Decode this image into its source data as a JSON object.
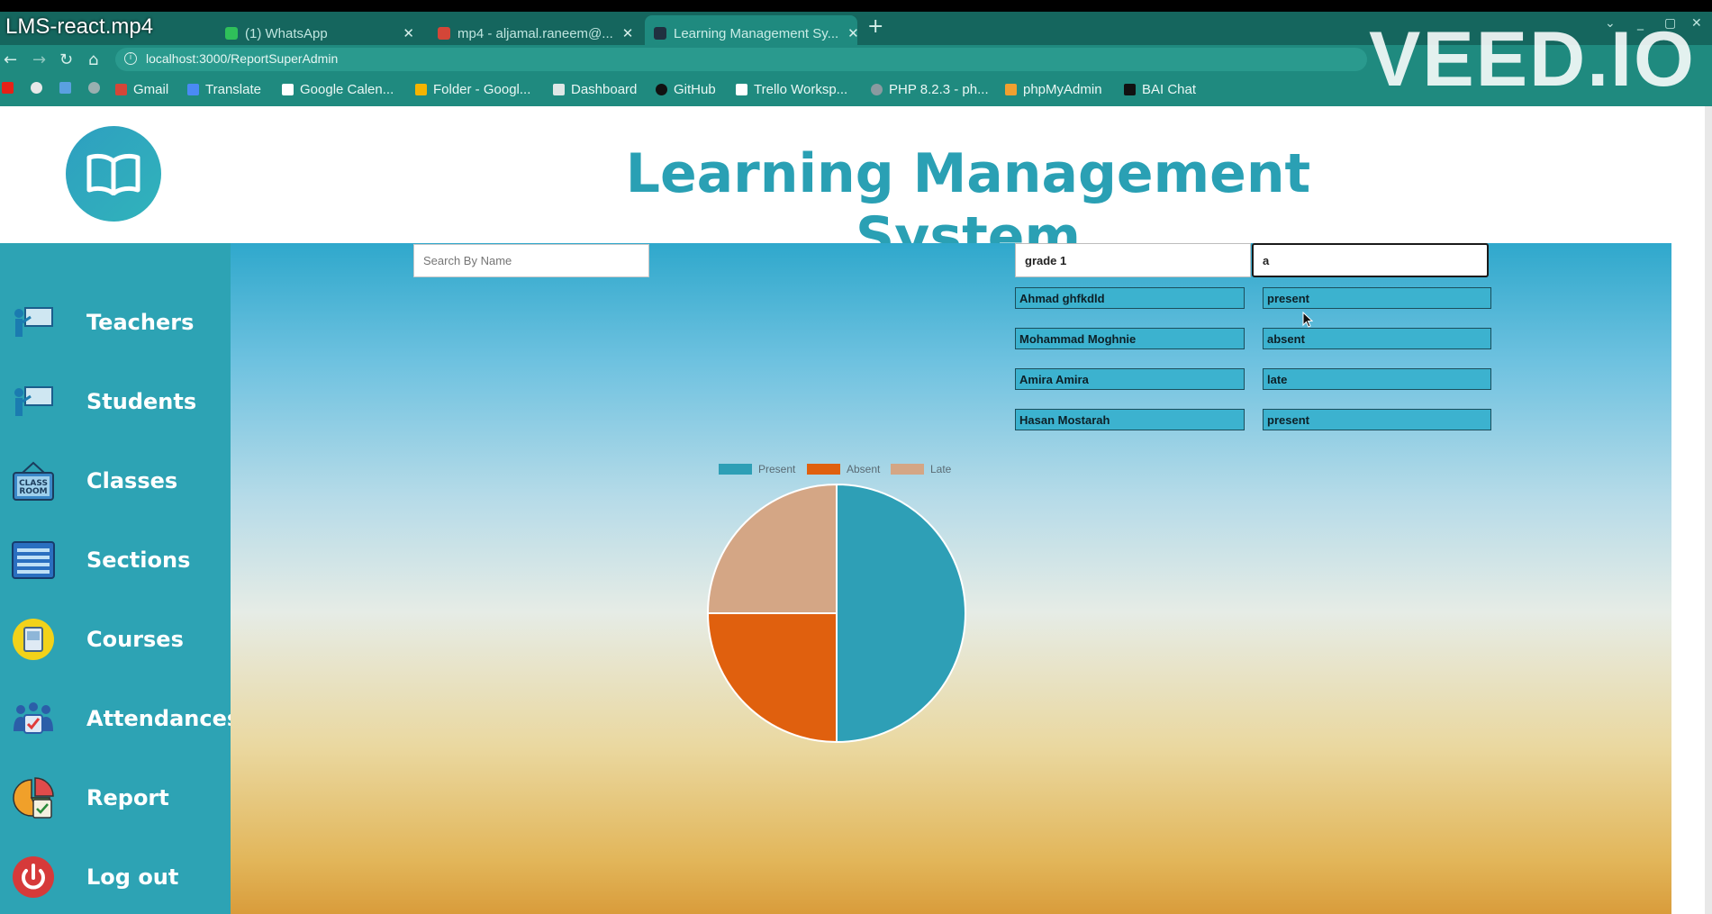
{
  "video_title": "LMS-react.mp4",
  "watermark": "VEED.IO",
  "browser": {
    "tabs": [
      {
        "label": "(1) WhatsApp",
        "active": false
      },
      {
        "label": "mp4 - aljamal.raneem@...",
        "active": false
      },
      {
        "label": "Learning Management Sy...",
        "active": true
      }
    ],
    "url": "localhost:3000/ReportSuperAdmin",
    "bookmarks": [
      "Gmail",
      "Translate",
      "Google Calen...",
      "Folder - Googl...",
      "Dashboard",
      "GitHub",
      "Trello Worksp...",
      "PHP 8.2.3 - ph...",
      "phpMyAdmin",
      "BAI Chat"
    ]
  },
  "header": {
    "title": "Learning Management System"
  },
  "sidebar": {
    "items": [
      {
        "label": "Teachers",
        "icon": "teacher-board-icon"
      },
      {
        "label": "Students",
        "icon": "student-board-icon"
      },
      {
        "label": "Classes",
        "icon": "classroom-sign-icon"
      },
      {
        "label": "Sections",
        "icon": "sections-list-icon"
      },
      {
        "label": "Courses",
        "icon": "course-book-icon"
      },
      {
        "label": "Attendances",
        "icon": "attendance-group-icon"
      },
      {
        "label": "Report",
        "icon": "report-pie-icon"
      },
      {
        "label": "Log out",
        "icon": "power-icon"
      }
    ]
  },
  "filters": {
    "search_placeholder": "Search By Name",
    "grade_value": "grade 1",
    "section_value": "a"
  },
  "attendance_rows": [
    {
      "name": "Ahmad ghfkdld",
      "status": "present"
    },
    {
      "name": "Mohammad Moghnie",
      "status": "absent"
    },
    {
      "name": "Amira Amira",
      "status": "late"
    },
    {
      "name": "Hasan Mostarah",
      "status": "present"
    }
  ],
  "colors": {
    "present": "#2e9fb6",
    "absent": "#e0600e",
    "late": "#d4a685",
    "sidebar": "#2da3b4",
    "title": "#2aa0b4"
  },
  "chart_data": {
    "type": "pie",
    "categories": [
      "Present",
      "Absent",
      "Late"
    ],
    "values": [
      2,
      1,
      1
    ],
    "legend_position": "top",
    "title": ""
  }
}
